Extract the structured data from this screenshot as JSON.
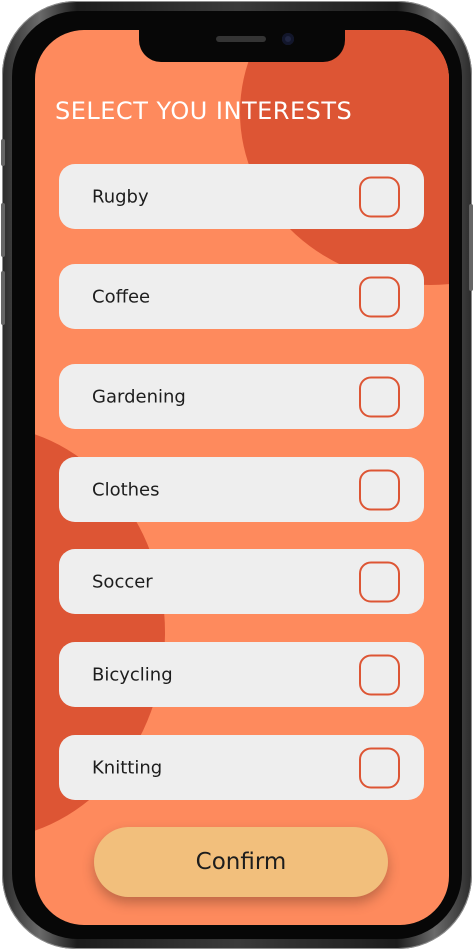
{
  "screen": {
    "title": "SELECT YOU INTERESTS"
  },
  "interests": [
    {
      "label": "Rugby",
      "checked": false
    },
    {
      "label": "Coffee",
      "checked": false
    },
    {
      "label": "Gardening",
      "checked": false
    },
    {
      "label": "Clothes",
      "checked": false
    },
    {
      "label": "Soccer",
      "checked": false
    },
    {
      "label": "Bicycling",
      "checked": false
    },
    {
      "label": "Knitting",
      "checked": false
    }
  ],
  "actions": {
    "confirm_label": "Confirm"
  },
  "colors": {
    "background": "#fe8a5d",
    "blob": "#dd5534",
    "card": "#eeeeee",
    "checkbox_border": "#dd5534",
    "button": "#f2bf7c",
    "title": "#ffffff",
    "text": "#1d1d1d"
  }
}
